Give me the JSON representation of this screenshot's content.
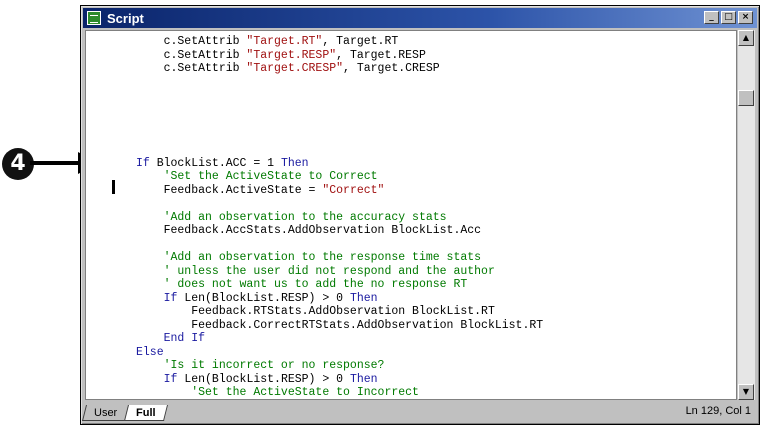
{
  "callout": {
    "number": "4"
  },
  "window": {
    "title": "Script",
    "controls": {
      "minimize": "_",
      "maximize": "□",
      "close": "×"
    }
  },
  "code_lines": [
    [
      {
        "t": "    c.SetAttrib ",
        "c": ""
      },
      {
        "t": "\"Target.RT\"",
        "c": "str"
      },
      {
        "t": ", Target.RT",
        "c": ""
      }
    ],
    [
      {
        "t": "    c.SetAttrib ",
        "c": ""
      },
      {
        "t": "\"Target.RESP\"",
        "c": "str"
      },
      {
        "t": ", Target.RESP",
        "c": ""
      }
    ],
    [
      {
        "t": "    c.SetAttrib ",
        "c": ""
      },
      {
        "t": "\"Target.CRESP\"",
        "c": "str"
      },
      {
        "t": ", Target.CRESP",
        "c": ""
      }
    ],
    [],
    [],
    [],
    [],
    [],
    [],
    [
      {
        "t": "If ",
        "c": "kw"
      },
      {
        "t": "BlockList.ACC = 1 ",
        "c": ""
      },
      {
        "t": "Then",
        "c": "kw"
      }
    ],
    [
      {
        "t": "    'Set the ActiveState to Correct",
        "c": "cm"
      }
    ],
    [
      {
        "t": "    Feedback.ActiveState = ",
        "c": ""
      },
      {
        "t": "\"Correct\"",
        "c": "str"
      }
    ],
    [],
    [
      {
        "t": "    'Add an observation to the accuracy stats",
        "c": "cm"
      }
    ],
    [
      {
        "t": "    Feedback.AccStats.AddObservation BlockList.Acc",
        "c": ""
      }
    ],
    [],
    [
      {
        "t": "    'Add an observation to the response time stats",
        "c": "cm"
      }
    ],
    [
      {
        "t": "    ' unless the user did not respond and the author",
        "c": "cm"
      }
    ],
    [
      {
        "t": "    ' does not want us to add the no response RT",
        "c": "cm"
      }
    ],
    [
      {
        "t": "    ",
        "c": ""
      },
      {
        "t": "If ",
        "c": "kw"
      },
      {
        "t": "Len(BlockList.RESP) > 0 ",
        "c": ""
      },
      {
        "t": "Then",
        "c": "kw"
      }
    ],
    [
      {
        "t": "        Feedback.RTStats.AddObservation BlockList.RT",
        "c": ""
      }
    ],
    [
      {
        "t": "        Feedback.CorrectRTStats.AddObservation BlockList.RT",
        "c": ""
      }
    ],
    [
      {
        "t": "    ",
        "c": ""
      },
      {
        "t": "End If",
        "c": "kw"
      }
    ],
    [
      {
        "t": "Else",
        "c": "kw"
      }
    ],
    [
      {
        "t": "    'Is it incorrect or no response?",
        "c": "cm"
      }
    ],
    [
      {
        "t": "    ",
        "c": ""
      },
      {
        "t": "If ",
        "c": "kw"
      },
      {
        "t": "Len(BlockList.RESP) > 0 ",
        "c": ""
      },
      {
        "t": "Then",
        "c": "kw"
      }
    ],
    [
      {
        "t": "        'Set the ActiveState to Incorrect",
        "c": "cm"
      }
    ]
  ],
  "tabs": [
    {
      "label": "User",
      "active": false
    },
    {
      "label": "Full",
      "active": true
    }
  ],
  "status": "Ln 129, Col 1",
  "scroll": {
    "up": "▲",
    "down": "▼",
    "left": "◀",
    "right": "▶"
  }
}
